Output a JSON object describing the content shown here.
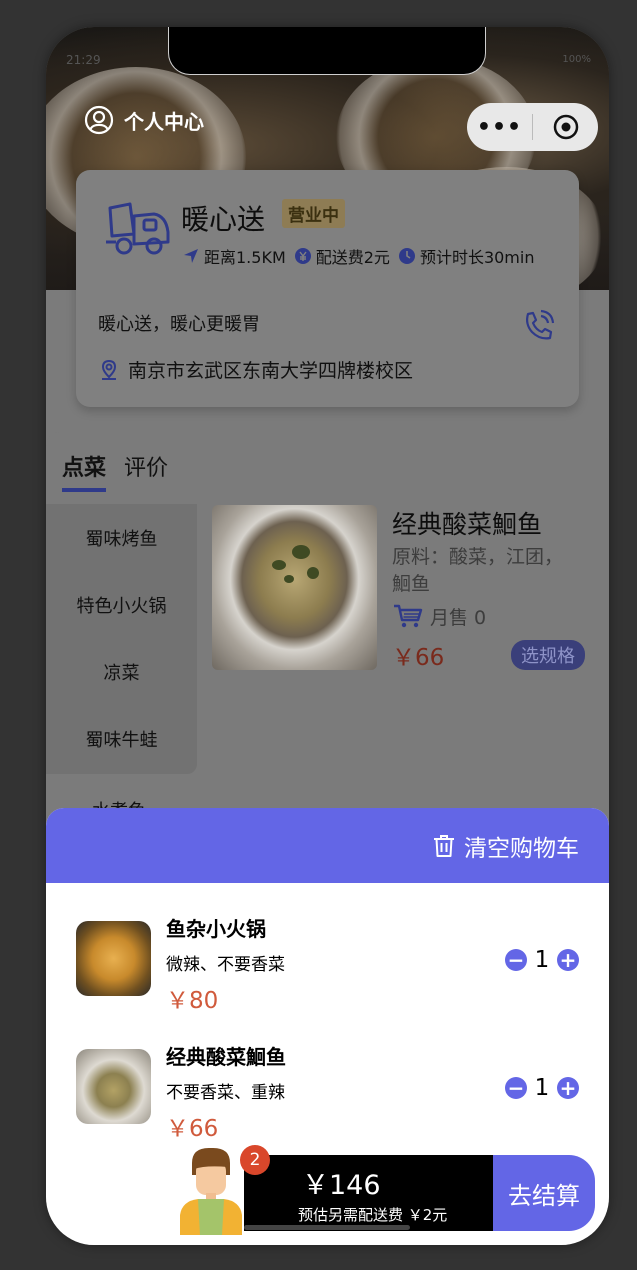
{
  "status": {
    "time": "21:29",
    "right": "100%"
  },
  "header": {
    "user_center_label": "个人中心"
  },
  "shop": {
    "name": "暖心送",
    "status_badge": "营业中",
    "distance": "距离1.5KM",
    "delivery_fee": "配送费2元",
    "eta": "预计时长30min",
    "slogan": "暖心送，暖心更暖胃",
    "address": "南京市玄武区东南大学四牌楼校区"
  },
  "tabs": [
    {
      "label": "点菜"
    },
    {
      "label": "评价"
    }
  ],
  "categories": [
    "蜀味烤鱼",
    "特色小火锅",
    "凉菜",
    "蜀味牛蛙",
    "水煮鱼"
  ],
  "dish": {
    "title": "经典酸菜鮰鱼",
    "description": "原料：酸菜，江团，鮰鱼",
    "sales": "月售 0",
    "price": "￥66",
    "spec_button": "选规格"
  },
  "cart": {
    "clear_label": "清空购物车",
    "items": [
      {
        "name": "鱼杂小火锅",
        "options": "微辣、不要香菜",
        "price": "￥80",
        "qty": "1"
      },
      {
        "name": "经典酸菜鮰鱼",
        "options": "不要香菜、重辣",
        "price": "￥66",
        "qty": "1"
      }
    ],
    "badge_count": "2",
    "total": "￥146",
    "fee_note": "预估另需配送费 ￥2元",
    "checkout_label": "去结算"
  },
  "colors": {
    "accent": "#6366e6",
    "price_red": "#d05a3c",
    "badge_red": "#d9472b"
  },
  "icons": [
    "user-icon",
    "more-dots-icon",
    "target-icon",
    "delivery-truck-icon",
    "navigation-arrow-icon",
    "yen-coin-icon",
    "clock-icon",
    "phone-call-icon",
    "location-pin-icon",
    "shopping-cart-icon",
    "trash-icon",
    "minus-icon",
    "plus-icon"
  ]
}
